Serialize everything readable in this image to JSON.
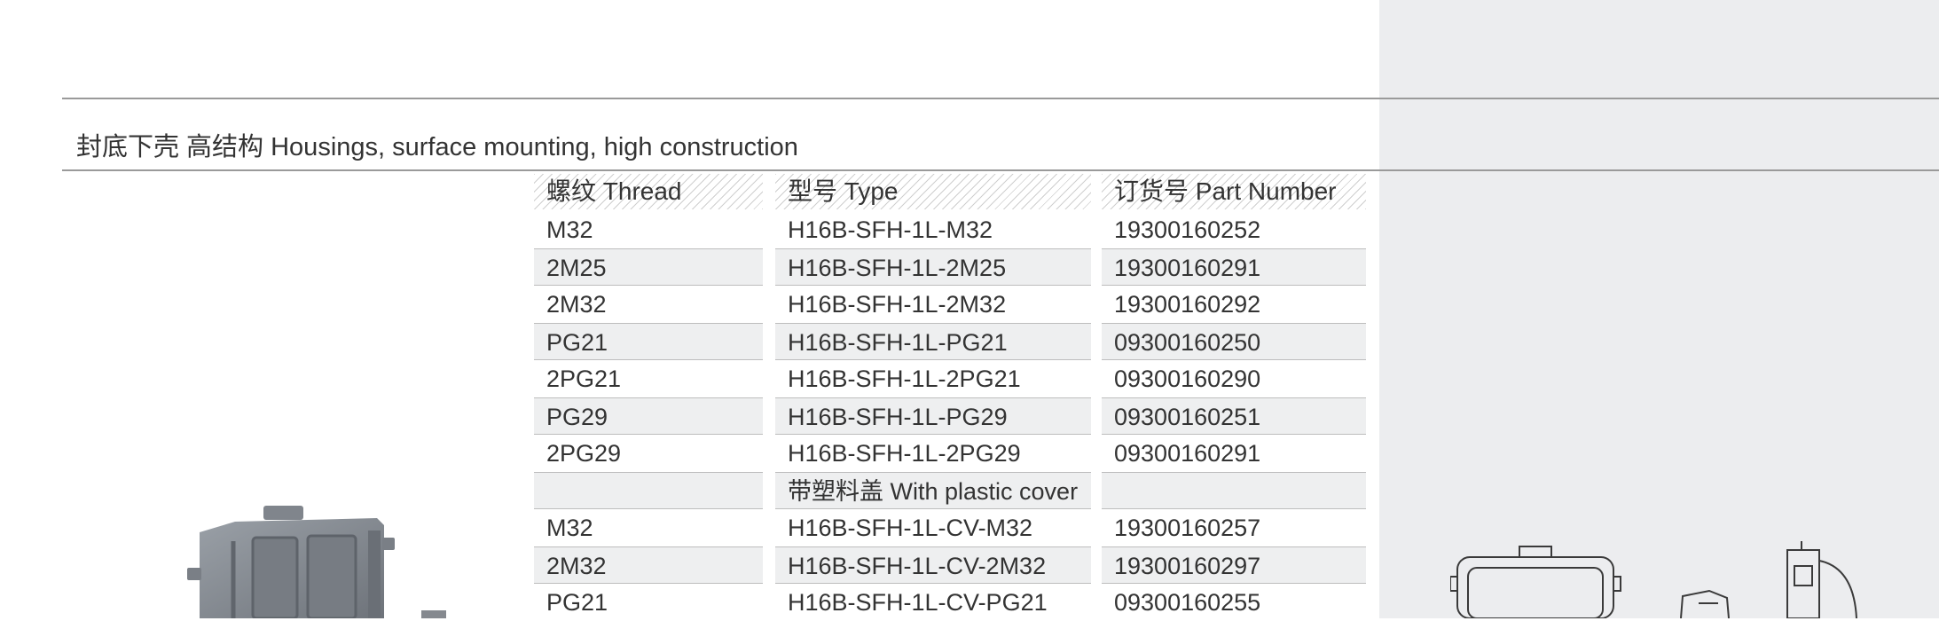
{
  "section_title": "封底下壳 高结构 Housings, surface mounting, high construction",
  "table": {
    "headers": [
      "螺纹 Thread",
      "型号 Type",
      "订货号 Part Number"
    ],
    "rows": [
      {
        "thread": "M32",
        "type": "H16B-SFH-1L-M32",
        "part": "19300160252"
      },
      {
        "thread": "2M25",
        "type": "H16B-SFH-1L-2M25",
        "part": "19300160291"
      },
      {
        "thread": "2M32",
        "type": "H16B-SFH-1L-2M32",
        "part": "19300160292"
      },
      {
        "thread": "PG21",
        "type": "H16B-SFH-1L-PG21",
        "part": "09300160250"
      },
      {
        "thread": "2PG21",
        "type": "H16B-SFH-1L-2PG21",
        "part": "09300160290"
      },
      {
        "thread": "PG29",
        "type": "H16B-SFH-1L-PG29",
        "part": "09300160251"
      },
      {
        "thread": "2PG29",
        "type": "H16B-SFH-1L-2PG29",
        "part": "09300160291"
      },
      {
        "thread": "",
        "type": "带塑料盖 With plastic cover",
        "part": ""
      },
      {
        "thread": "M32",
        "type": "H16B-SFH-1L-CV-M32",
        "part": "19300160257"
      },
      {
        "thread": "2M32",
        "type": "H16B-SFH-1L-CV-2M32",
        "part": "19300160297"
      },
      {
        "thread": "PG21",
        "type": "H16B-SFH-1L-CV-PG21",
        "part": "09300160255"
      }
    ]
  },
  "colors": {
    "panel": "#ecedef",
    "rule": "#9a9a9a",
    "shade": "#eeeff0",
    "housing": "#8a8f96"
  }
}
